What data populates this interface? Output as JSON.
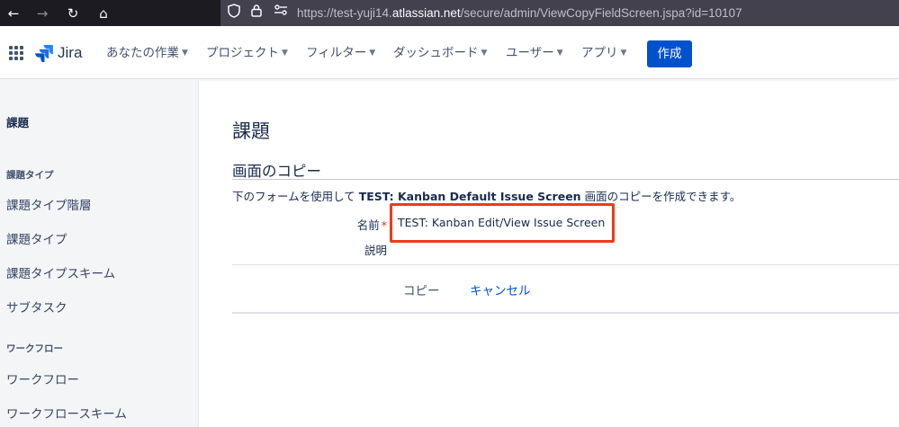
{
  "browser": {
    "back_icon": "←",
    "forward_icon": "→",
    "reload_icon": "↻",
    "home_icon": "⌂",
    "url_prefix": "https://test-yuji14.",
    "url_host": "atlassian.net",
    "url_path": "/secure/admin/ViewCopyFieldScreen.jspa?id=10107"
  },
  "header": {
    "logo_text": "Jira",
    "menu": [
      {
        "label": "あなたの作業"
      },
      {
        "label": "プロジェクト"
      },
      {
        "label": "フィルター"
      },
      {
        "label": "ダッシュボード"
      },
      {
        "label": "ユーザー"
      },
      {
        "label": "アプリ"
      }
    ],
    "create_label": "作成",
    "brand_color": "#0052cc"
  },
  "sidebar": {
    "title": "課題",
    "sections": [
      {
        "heading": "課題タイプ",
        "items": [
          {
            "label": "課題タイプ階層"
          },
          {
            "label": "課題タイプ"
          },
          {
            "label": "課題タイプスキーム"
          },
          {
            "label": "サブタスク"
          }
        ]
      },
      {
        "heading": "ワークフロー",
        "items": [
          {
            "label": "ワークフロー"
          },
          {
            "label": "ワークフロースキーム"
          }
        ]
      }
    ]
  },
  "main": {
    "page_title": "課題",
    "form_title": "画面のコピー",
    "description_prefix": "下のフォームを使用して ",
    "description_bold": "TEST: Kanban Default Issue Screen",
    "description_suffix": " 画面のコピーを作成できます。",
    "name_label": "名前",
    "required_mark": "*",
    "name_value": "TEST: Kanban Edit/View Issue Screen",
    "desc_label": "説明",
    "copy_button": "コピー",
    "cancel_link": "キャンセル",
    "highlight_color": "#f03a17"
  }
}
